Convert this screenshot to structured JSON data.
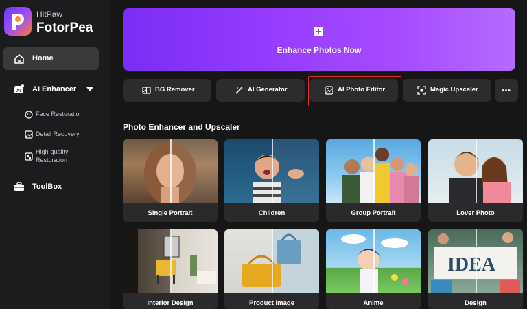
{
  "brand": {
    "top": "HitPaw",
    "main": "FotorPea"
  },
  "sidebar": {
    "home": "Home",
    "ai_enhancer": "AI Enhancer",
    "sub_items": [
      {
        "label": "Face Restoration"
      },
      {
        "label": "Detail Recovery"
      },
      {
        "label": "High-quality\nRestoration"
      }
    ],
    "toolbox": "ToolBox"
  },
  "hero": {
    "label": "Enhance Photos Now"
  },
  "tools": [
    {
      "label": "BG Remover"
    },
    {
      "label": "AI Generator"
    },
    {
      "label": "AI Photo Editor"
    },
    {
      "label": "Magic Upscaler"
    }
  ],
  "more_icon": "ellipsis-icon",
  "section": {
    "title": "Photo Enhancer and Upscaler"
  },
  "cards": [
    {
      "label": "Single Portrait"
    },
    {
      "label": "Children"
    },
    {
      "label": "Group Portrait"
    },
    {
      "label": "Lover Photo"
    },
    {
      "label": "Interior Design"
    },
    {
      "label": "Product Image"
    },
    {
      "label": "Anime"
    },
    {
      "label": "Design"
    }
  ],
  "colors": {
    "accent": "#8a3cff",
    "highlight": "#e02a2a",
    "sidebar_active": "#3a3a3d"
  }
}
